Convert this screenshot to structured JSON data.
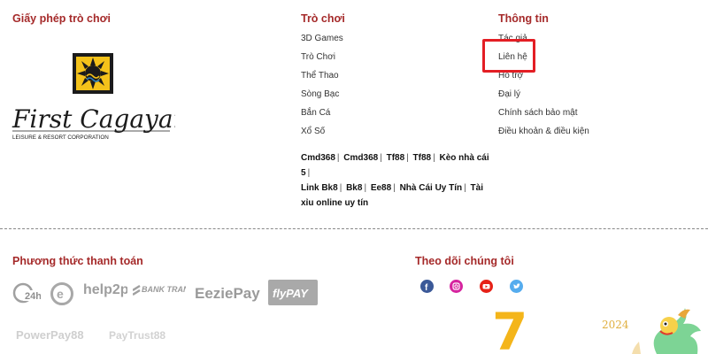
{
  "license": {
    "heading": "Giấy phép trò chơi",
    "logo_text": "First Cagayan",
    "logo_subtext": "LEISURE & RESORT CORPORATION"
  },
  "games": {
    "heading": "Trò chơi",
    "items": [
      "3D Games",
      "Trò Chơi",
      "Thể Thao",
      "Sòng Bạc",
      "Bắn Cá",
      "Xổ Số"
    ]
  },
  "partners": [
    "Cmd368",
    "Cmd368",
    "Tf88",
    "Tf88",
    "Kèo nhà cái 5",
    "Link Bk8",
    "Bk8",
    "Ee88",
    "Nhà Cái Uy Tín",
    "Tài xỉu online uy tín"
  ],
  "info": {
    "heading": "Thông tin",
    "items": [
      "Tác giả",
      "Liên hệ",
      "Hỗ trợ",
      "Đại lý",
      "Chính sách bảo mật",
      "Điều khoản & điều kiện"
    ]
  },
  "payment": {
    "heading": "Phương thức thanh toán",
    "methods": [
      "24h",
      "e",
      "help2pay",
      "BANK TRANSFER",
      "EeziePay",
      "flyPAY",
      "PowerPay88",
      "PayTrust88"
    ]
  },
  "follow": {
    "heading": "Theo dõi chúng tôi",
    "icons": [
      "facebook-icon",
      "instagram-icon",
      "youtube-icon",
      "twitter-icon"
    ],
    "colors": [
      "#3b5998",
      "#d6249f",
      "#e62117",
      "#55acee"
    ]
  },
  "decoration": {
    "number": "7",
    "year": "2024"
  }
}
